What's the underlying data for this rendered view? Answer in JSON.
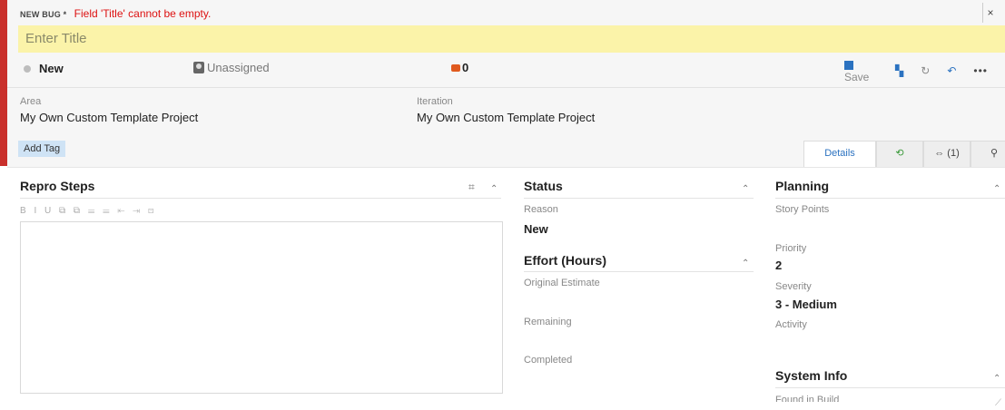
{
  "header": {
    "work_item_type": "NEW BUG *",
    "error_message": "Field 'Title' cannot be empty.",
    "close_label": "×",
    "title_placeholder": "Enter Title",
    "title_value": "",
    "state": "New",
    "assigned_to": "Unassigned",
    "comment_count": "0",
    "toolbar": {
      "save_label": "Save",
      "refresh_icon": "↻",
      "undo_icon": "↶",
      "more_label": "•••"
    }
  },
  "fields": {
    "area_label": "Area",
    "area_value": "My Own Custom Template Project",
    "iteration_label": "Iteration",
    "iteration_value": "My Own Custom Template Project",
    "add_tag_label": "Add Tag"
  },
  "tabs": [
    {
      "label": "Details"
    },
    {
      "label": "history-icon"
    },
    {
      "label": "(1)"
    },
    {
      "label": "attachment-icon"
    }
  ],
  "repro": {
    "title": "Repro Steps",
    "toolbar": "B I U ⧉ ⧉ ☰ ☰ ⇤ ⇥ ⊡"
  },
  "status": {
    "title": "Status",
    "reason_label": "Reason",
    "reason_value": "New"
  },
  "effort": {
    "title": "Effort (Hours)",
    "original_estimate_label": "Original Estimate",
    "remaining_label": "Remaining",
    "completed_label": "Completed"
  },
  "planning": {
    "title": "Planning",
    "story_points_label": "Story Points",
    "priority_label": "Priority",
    "priority_value": "2",
    "severity_label": "Severity",
    "severity_value": "3 - Medium",
    "activity_label": "Activity"
  },
  "system_info": {
    "title": "System Info",
    "found_in_build_label": "Found in Build"
  },
  "colors": {
    "accent": "#c9302c",
    "link": "#2b72c0",
    "title_bg": "#fbf3a9",
    "comment": "#e05a1f"
  }
}
